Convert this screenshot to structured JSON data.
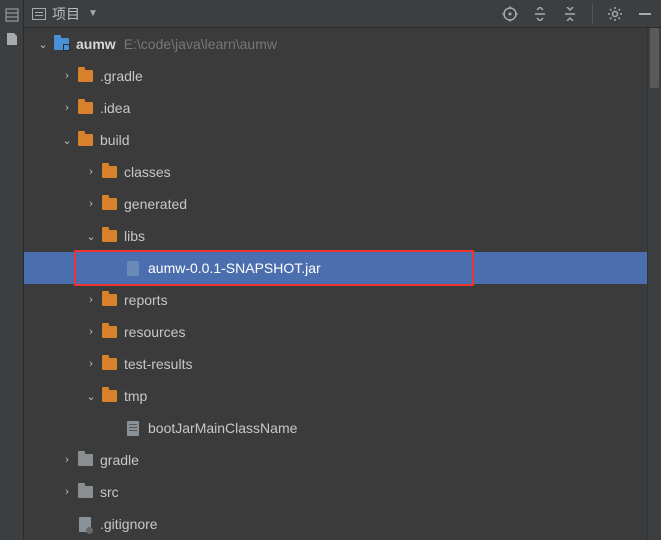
{
  "header": {
    "title": "项目"
  },
  "tree": {
    "root": {
      "name": "aumw",
      "path": "E:\\code\\java\\learn\\aumw"
    },
    "gradle_folder": ".gradle",
    "idea_folder": ".idea",
    "build_folder": "build",
    "classes_folder": "classes",
    "generated_folder": "generated",
    "libs_folder": "libs",
    "jar_file": "aumw-0.0.1-SNAPSHOT.jar",
    "reports_folder": "reports",
    "resources_folder": "resources",
    "test_results_folder": "test-results",
    "tmp_folder": "tmp",
    "boot_jar_file": "bootJarMainClassName",
    "gradle_folder2": "gradle",
    "src_folder": "src",
    "gitignore_file": ".gitignore"
  }
}
